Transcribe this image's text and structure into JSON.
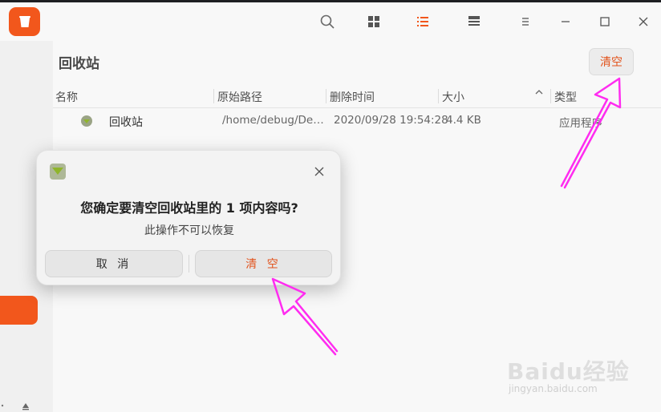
{
  "window": {
    "title": "回收站",
    "icons": {
      "app": "trash-app-icon",
      "search": "search-icon",
      "icon_view": "grid-view-icon",
      "list_view": "list-view-icon",
      "extend_view": "extend-view-icon",
      "menu": "menu-icon",
      "minimize": "minimize-icon",
      "maximize": "maximize-icon",
      "close": "close-icon"
    }
  },
  "toolbar": {
    "empty_label": "清空"
  },
  "table": {
    "columns": [
      "名称",
      "原始路径",
      "删除时间",
      "大小",
      "类型"
    ],
    "rows": [
      {
        "name": "回收站",
        "path": "/home/debug/De…",
        "time": "2020/09/28 19:54:28",
        "size": "4.4 KB",
        "type": "应用程序"
      }
    ]
  },
  "dialog": {
    "title": "您确定要清空回收站里的 1 项内容吗?",
    "message": "此操作不可以恢复",
    "cancel_label": "取 消",
    "confirm_label": "清 空"
  },
  "watermark": {
    "main": "Baidu经验",
    "sub": "jingyan.baidu.com"
  },
  "colors": {
    "accent": "#f2571c",
    "annotation": "#ff2cf0"
  }
}
